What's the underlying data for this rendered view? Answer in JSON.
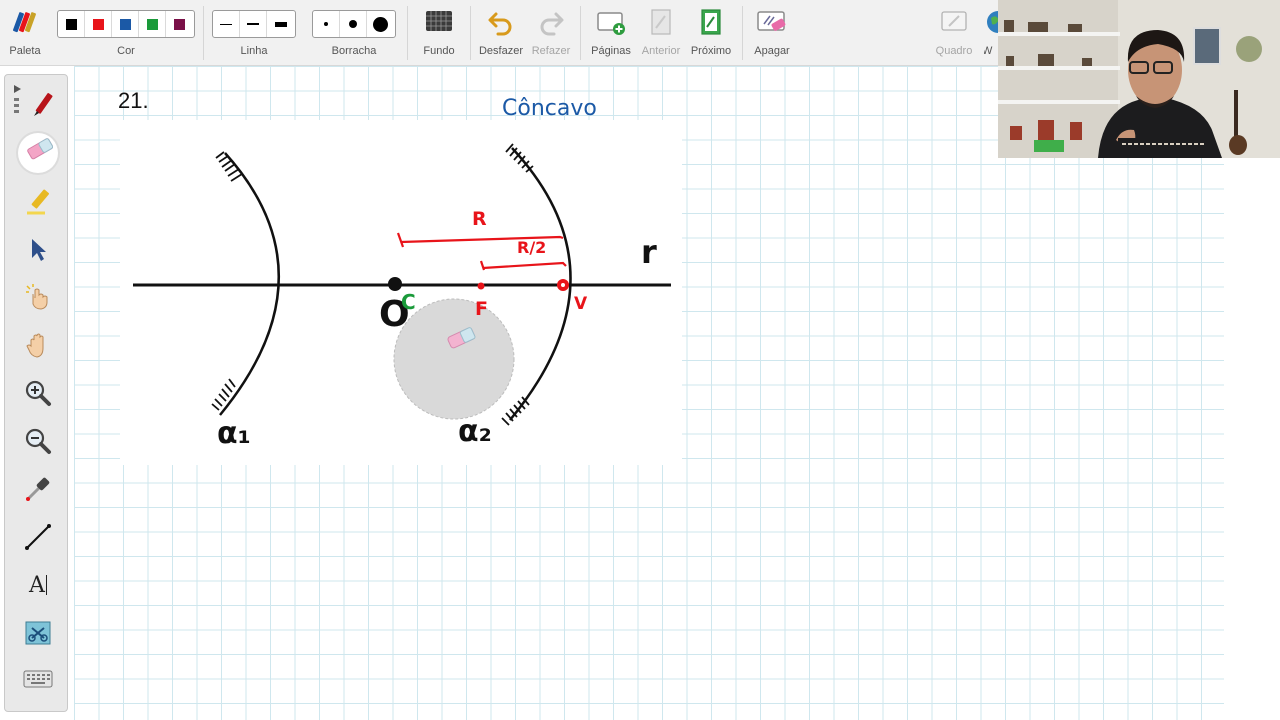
{
  "toolbar": {
    "paleta": "Paleta",
    "cor": "Cor",
    "linha": "Linha",
    "borracha": "Borracha",
    "fundo": "Fundo",
    "desfazer": "Desfazer",
    "refazer": "Refazer",
    "paginas": "Páginas",
    "anterior": "Anterior",
    "proximo": "Próximo",
    "apagar": "Apagar",
    "quadro": "Quadro",
    "web_partial": "W",
    "colors": [
      "#000000",
      "#e8141a",
      "#1b59a6",
      "#1a9a3a",
      "#7a1048"
    ]
  },
  "palette": {
    "tools": [
      "pen-icon",
      "eraser-icon",
      "highlighter-icon",
      "pointer-icon",
      "touch-icon",
      "hand-icon",
      "zoom-in-icon",
      "zoom-out-icon",
      "color-picker-icon",
      "line-icon",
      "text-icon",
      "screenshot-icon",
      "keyboard-icon"
    ],
    "text_tool_label": "A"
  },
  "canvas": {
    "question_number": "21.",
    "handwritten_title": "Côncavo",
    "figure": {
      "label_r": "r",
      "label_O": "O",
      "label_alpha1": "α₁",
      "label_alpha2": "α₂"
    },
    "annotations": {
      "C": "C",
      "F": "F",
      "V": "V",
      "R": "R",
      "R2": "R/2"
    },
    "annotation_color": "#e8141a",
    "center_color": "#1a9a3a",
    "title_color": "#1b59a6"
  }
}
